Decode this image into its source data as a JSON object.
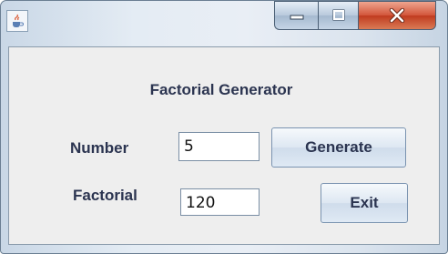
{
  "window": {
    "controls": {
      "minimize_icon": "minimize-icon",
      "maximize_icon": "maximize-icon",
      "close_icon": "close-icon"
    },
    "app_icon": "java-cup-icon"
  },
  "form": {
    "heading": "Factorial Generator",
    "number_label": "Number",
    "number_value": "5",
    "factorial_label": "Factorial",
    "factorial_value": "120",
    "generate_label": "Generate",
    "exit_label": "Exit"
  },
  "colors": {
    "close_button": "#c8452a",
    "text": "#2b3450"
  }
}
